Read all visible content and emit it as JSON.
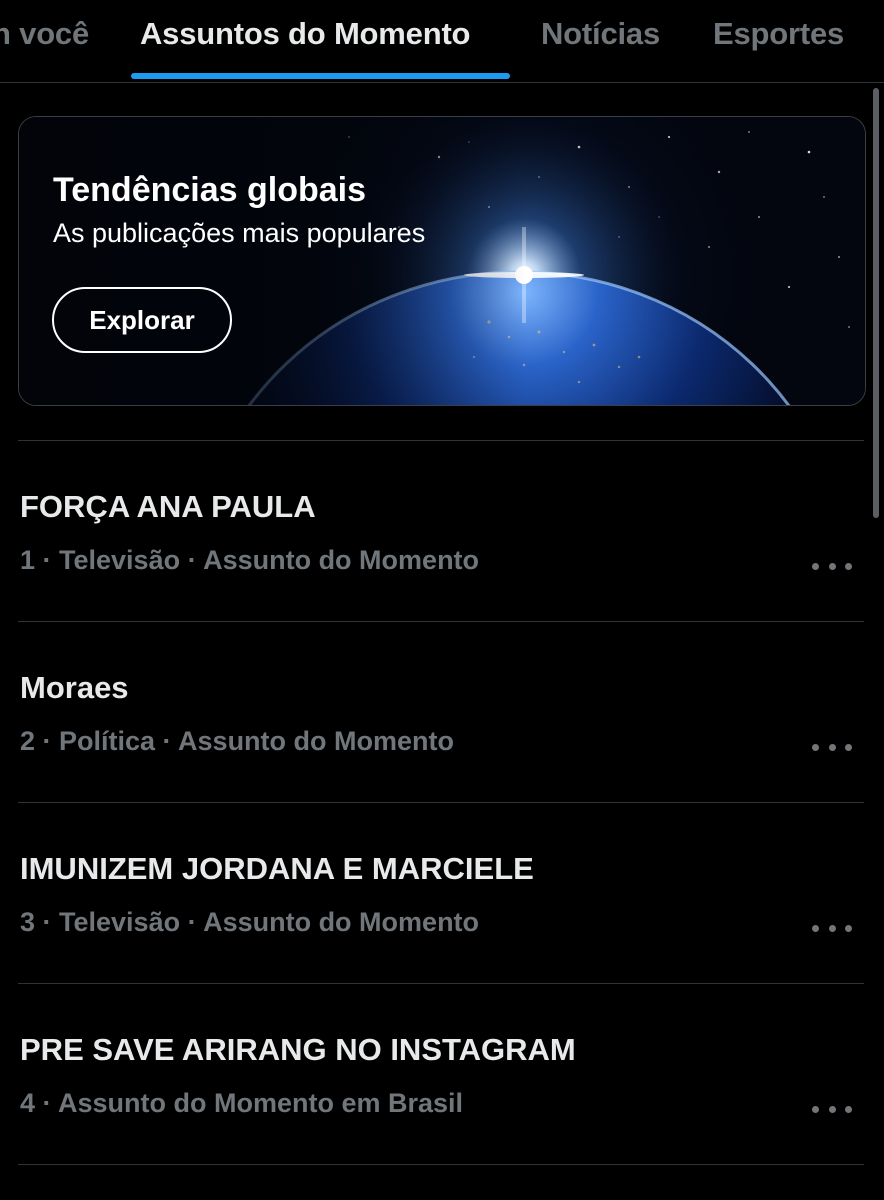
{
  "tabs": [
    {
      "label": "n você",
      "active": false
    },
    {
      "label": "Assuntos do Momento",
      "active": true
    },
    {
      "label": "Notícias",
      "active": false
    },
    {
      "label": "Esportes",
      "active": false
    }
  ],
  "banner": {
    "title": "Tendências globais",
    "subtitle": "As publicações mais populares",
    "button_label": "Explorar"
  },
  "trends": [
    {
      "title": "FORÇA ANA PAULA",
      "meta": "1 · Televisão · Assunto do Momento"
    },
    {
      "title": "Moraes",
      "meta": "2 · Política · Assunto do Momento"
    },
    {
      "title": "IMUNIZEM JORDANA E MARCIELE",
      "meta": "3 · Televisão · Assunto do Momento"
    },
    {
      "title": "PRE SAVE ARIRANG NO INSTAGRAM",
      "meta": "4 · Assunto do Momento em Brasil"
    }
  ],
  "colors": {
    "background": "#000000",
    "accent": "#1d9bf0",
    "text_primary": "#e7e9ea",
    "text_secondary": "#71767b",
    "divider": "#2f3336"
  }
}
